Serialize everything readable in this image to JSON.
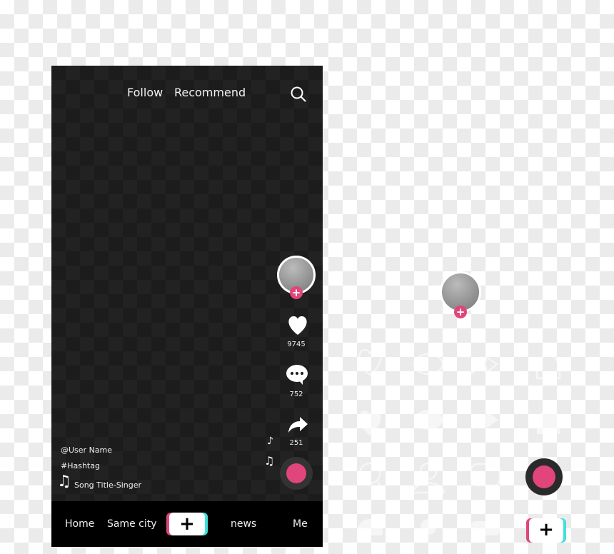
{
  "header": {
    "tabs": [
      {
        "label": "Follow"
      },
      {
        "label": "Recommend"
      }
    ],
    "search_icon": "search-icon"
  },
  "sidebar": {
    "likes": "9745",
    "comments": "752",
    "shares": "251"
  },
  "video_info": {
    "user": "@User Name",
    "hashtag": "#Hashtag",
    "song": "Song Title-Singer"
  },
  "nav": {
    "items": [
      {
        "label": "Home"
      },
      {
        "label": "Same city"
      },
      {
        "label": "+"
      },
      {
        "label": "news"
      },
      {
        "label": "Me"
      }
    ]
  },
  "icon_set": {
    "create_label": "+"
  },
  "colors": {
    "accent": "#e0457b",
    "cyan": "#3ee0dc",
    "dark": "#1c1c1c"
  }
}
